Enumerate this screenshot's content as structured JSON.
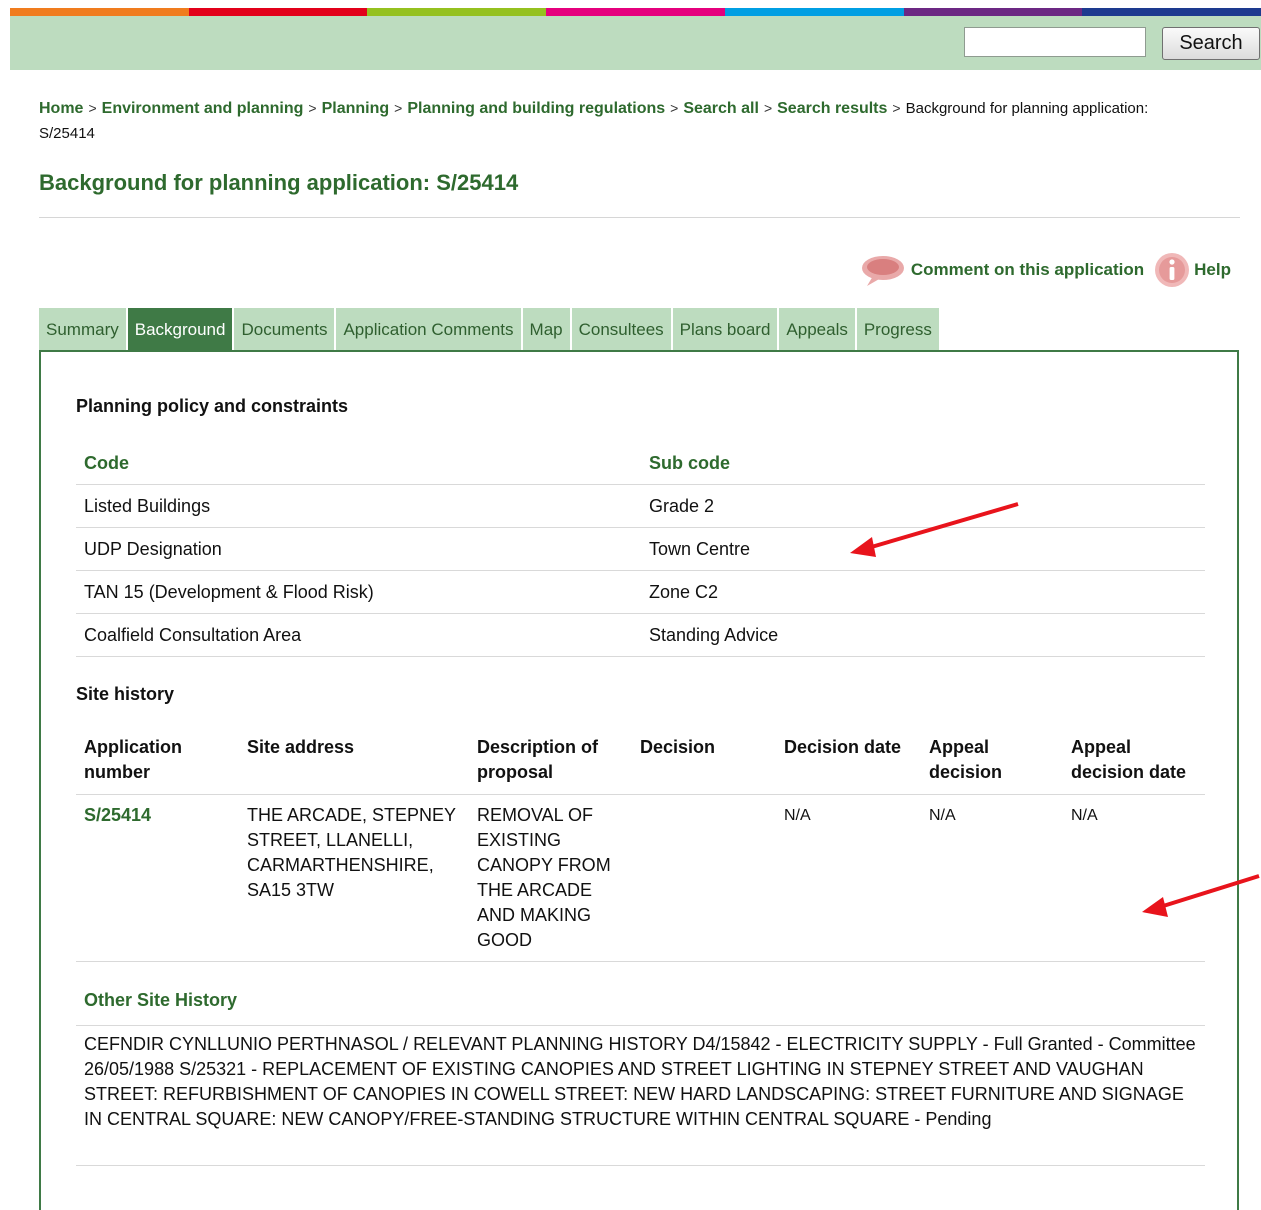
{
  "colors": {
    "brand_green": "#2e6a2e",
    "tab_active": "#3f7a46",
    "tab_inactive": "#bddcbf",
    "topbar": "#bddcbf",
    "annotation_arrow": "#e8141c",
    "rainbow": [
      "#f07c1e",
      "#e2001a",
      "#95c11f",
      "#e5007d",
      "#009fe3",
      "#6c2883",
      "#1d3a8f"
    ]
  },
  "header": {
    "search_placeholder": "",
    "search_button": "Search"
  },
  "breadcrumb": {
    "links": [
      "Home",
      "Environment and planning",
      "Planning",
      "Planning and building regulations",
      "Search all",
      "Search results"
    ],
    "separator": ">",
    "current": "Background for planning application: S/25414"
  },
  "page": {
    "title": "Background for planning application: S/25414"
  },
  "actions": {
    "comment": "Comment on this application",
    "comment_icon": "speech-bubble-icon",
    "help": "Help",
    "help_icon": "info-icon"
  },
  "tabs": [
    {
      "label": "Summary",
      "active": false
    },
    {
      "label": "Background",
      "active": true
    },
    {
      "label": "Documents",
      "active": false
    },
    {
      "label": "Application Comments",
      "active": false
    },
    {
      "label": "Map",
      "active": false
    },
    {
      "label": "Consultees",
      "active": false
    },
    {
      "label": "Plans board",
      "active": false
    },
    {
      "label": "Appeals",
      "active": false
    },
    {
      "label": "Progress",
      "active": false
    }
  ],
  "policy": {
    "heading": "Planning policy and constraints",
    "columns": [
      "Code",
      "Sub code"
    ],
    "rows": [
      [
        "Listed Buildings",
        "Grade 2"
      ],
      [
        "UDP Designation",
        "Town Centre"
      ],
      [
        "TAN 15 (Development & Flood Risk)",
        "Zone C2"
      ],
      [
        "Coalfield Consultation Area",
        "Standing Advice"
      ]
    ]
  },
  "site_history": {
    "heading": "Site history",
    "columns": [
      "Application number",
      "Site address",
      "Description of proposal",
      "Decision",
      "Decision date",
      "Appeal decision",
      "Appeal decision date"
    ],
    "rows": [
      {
        "application_number": "S/25414",
        "site_address": "THE ARCADE, STEPNEY STREET, LLANELLI, CARMARTHENSHIRE, SA15 3TW",
        "description": "REMOVAL OF EXISTING CANOPY FROM THE ARCADE AND MAKING GOOD",
        "decision": "",
        "decision_date": "N/A",
        "appeal_decision": "N/A",
        "appeal_decision_date": "N/A"
      }
    ]
  },
  "other_history": {
    "heading": "Other Site History",
    "text": "CEFNDIR CYNLLUNIO PERTHNASOL / RELEVANT PLANNING HISTORY D4/15842 - ELECTRICITY SUPPLY - Full Granted - Committee 26/05/1988 S/25321 - REPLACEMENT OF EXISTING CANOPIES AND STREET LIGHTING IN STEPNEY STREET AND VAUGHAN STREET: REFURBISHMENT OF CANOPIES IN COWELL STREET: NEW HARD LANDSCAPING: STREET FURNITURE AND SIGNAGE IN CENTRAL SQUARE: NEW CANOPY/FREE-STANDING STRUCTURE WITHIN CENTRAL SQUARE - Pending"
  }
}
